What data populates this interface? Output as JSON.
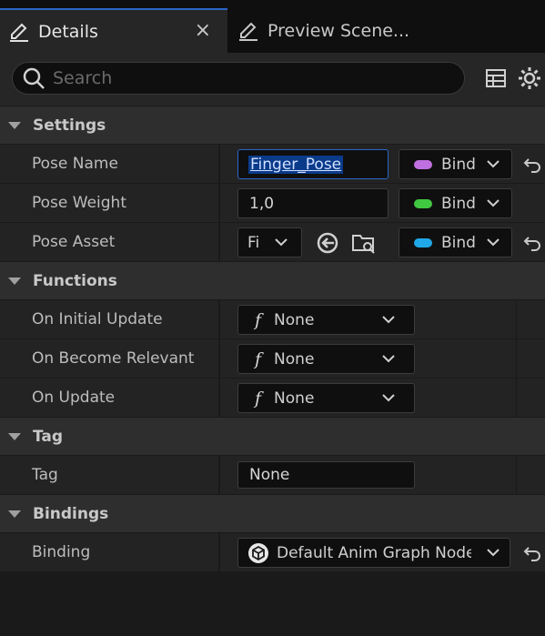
{
  "tabs": {
    "details_label": "Details",
    "preview_label": "Preview Scene...",
    "close_glyph": "×"
  },
  "search": {
    "placeholder": "Search"
  },
  "sections": {
    "settings": "Settings",
    "functions": "Functions",
    "tag": "Tag",
    "bindings": "Bindings"
  },
  "settings": {
    "pose_name_label": "Pose Name",
    "pose_name_value": "Finger_Pose",
    "pose_weight_label": "Pose Weight",
    "pose_weight_value": "1,0",
    "pose_asset_label": "Pose Asset",
    "pose_asset_value": "Fi",
    "bind_label": "Bind"
  },
  "functions": {
    "on_initial_update_label": "On Initial Update",
    "on_become_relevant_label": "On Become Relevant",
    "on_update_label": "On Update",
    "none_label": "None",
    "f_symbol": "f"
  },
  "tag": {
    "tag_label": "Tag",
    "tag_value": "None"
  },
  "bindings": {
    "binding_label": "Binding",
    "binding_value": "Default Anim Graph Node B"
  },
  "colors": {
    "pose_name_pill": "#c070e0",
    "pose_weight_pill": "#40c840",
    "pose_asset_pill": "#20a8e8",
    "accent": "#2a66c8"
  }
}
